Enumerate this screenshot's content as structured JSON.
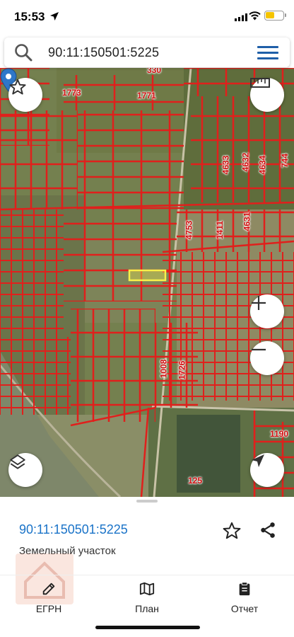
{
  "status": {
    "time": "15:53"
  },
  "search": {
    "query": "90:11:150501:5225"
  },
  "map": {
    "labels": [
      "1773",
      "1771",
      "4633",
      "4632",
      "4634",
      "744",
      "4753",
      "1411",
      "4631",
      "1008",
      "1726",
      "1190",
      "125",
      "330"
    ],
    "selected_fill": "#f7f04a",
    "parcel_line": "#e0201c"
  },
  "sheet": {
    "cadastral": "90:11:150501:5225",
    "type": "Земельный участок"
  },
  "tabs": [
    {
      "label": "ЕГРН"
    },
    {
      "label": "План"
    },
    {
      "label": "Отчет"
    }
  ],
  "colors": {
    "accent": "#1a73c8",
    "menu": "#1f5fa8"
  }
}
